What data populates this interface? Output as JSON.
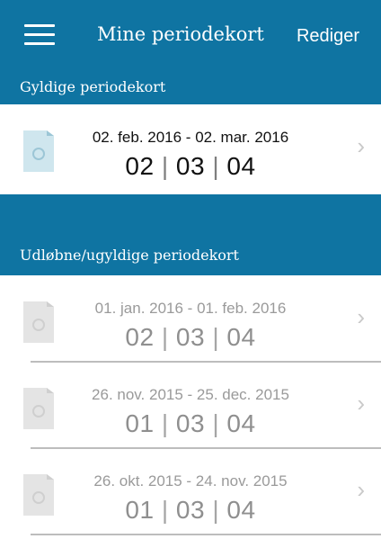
{
  "nav": {
    "title": "Mine periodekort",
    "action_label": "Rediger"
  },
  "sections": {
    "valid_label": "Gyldige periodekort",
    "expired_label": "Udløbne/ugyldige periodekort"
  },
  "valid_cards": [
    {
      "range": "02. feb. 2016 - 02. mar. 2016",
      "zones": [
        "02",
        "03",
        "04"
      ]
    }
  ],
  "expired_cards": [
    {
      "range": "01. jan. 2016 - 01. feb. 2016",
      "zones": [
        "02",
        "03",
        "04"
      ]
    },
    {
      "range": "26. nov. 2015 - 25. dec. 2015",
      "zones": [
        "01",
        "03",
        "04"
      ]
    },
    {
      "range": "26. okt. 2015 - 24. nov. 2015",
      "zones": [
        "01",
        "03",
        "04"
      ]
    }
  ],
  "colors": {
    "header_blue": "#0f74a2",
    "chevron": "#c9c9c9"
  },
  "icons": {
    "menu": "hamburger-menu-icon",
    "card": "travel-card-icon",
    "chevron": "chevron-right-icon"
  }
}
